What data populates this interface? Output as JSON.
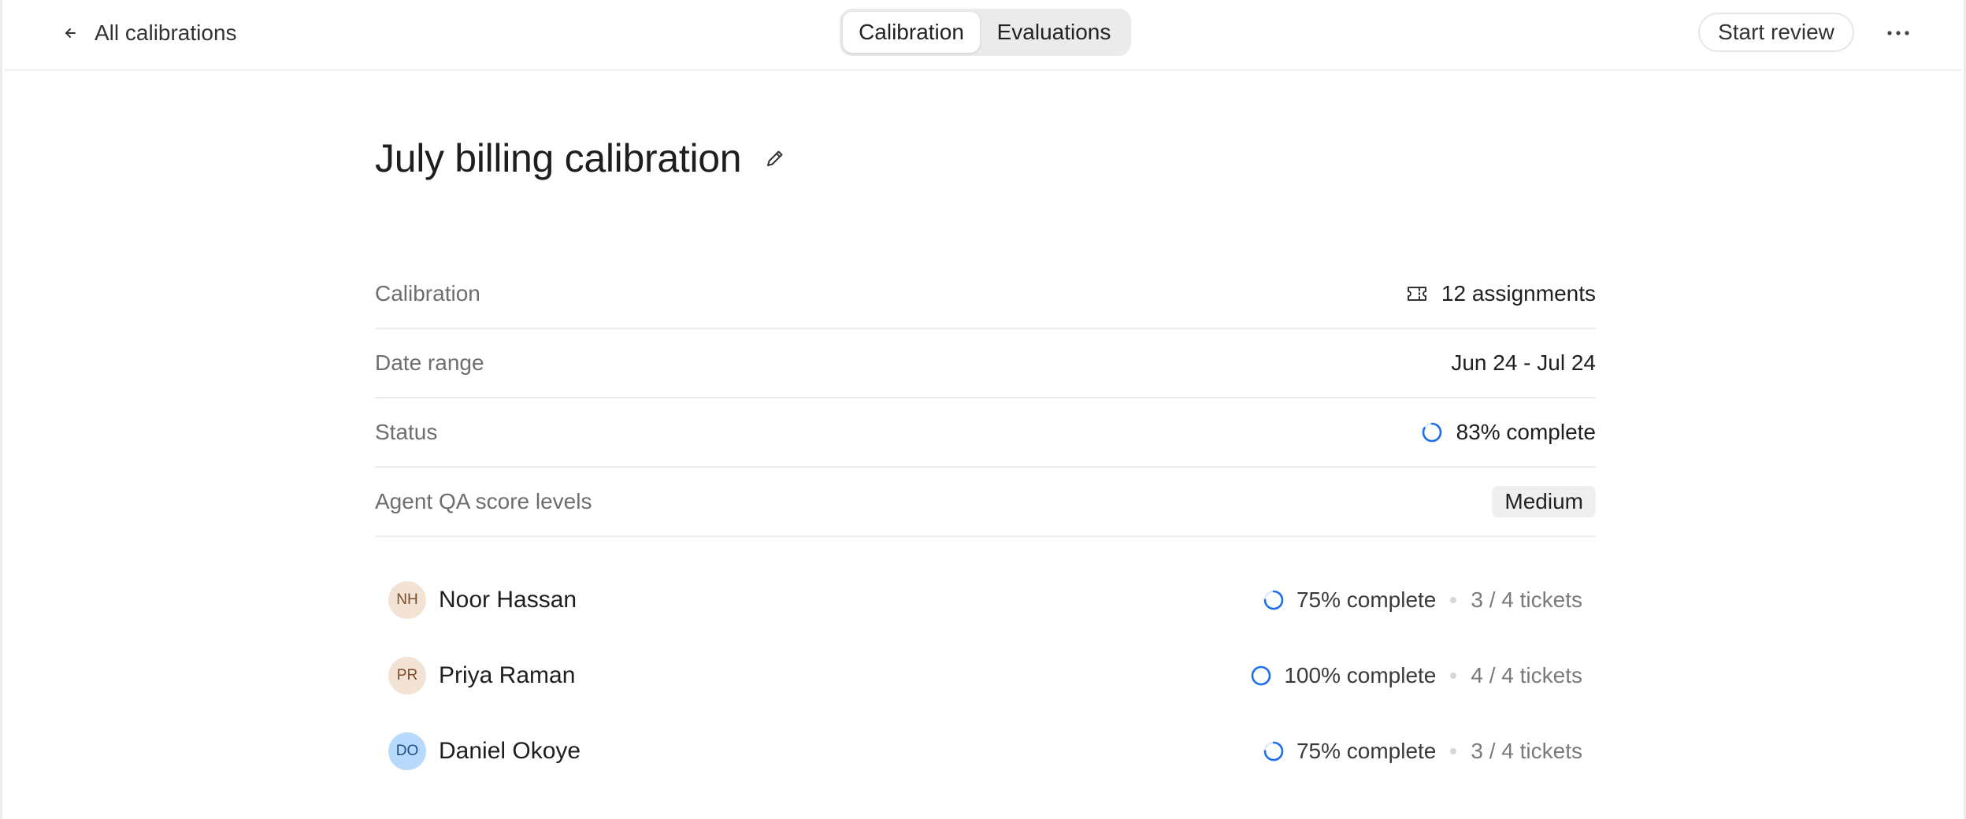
{
  "header": {
    "back_label": "All calibrations",
    "tabs": [
      {
        "label": "Calibration",
        "active": true
      },
      {
        "label": "Evaluations",
        "active": false
      }
    ],
    "start_review_label": "Start review",
    "more_icon": "more-horizontal-icon"
  },
  "page": {
    "title": "July billing calibration"
  },
  "properties": [
    {
      "label": "Calibration",
      "value": "12 assignments",
      "icon": "ticket-icon"
    },
    {
      "label": "Date range",
      "value": "Jun 24 - Jul 24"
    },
    {
      "label": "Status",
      "value": "83% complete",
      "progress": 0.83,
      "icon": "progress-ring-icon"
    },
    {
      "label": "Agent QA score levels",
      "value": "Medium"
    }
  ],
  "reviewers": [
    {
      "initials": "NH",
      "name": "Noor Hassan",
      "progress_label": "75% complete",
      "progress": 0.75,
      "tickets": "3 / 4 tickets",
      "avatar_bg": "#f3e3d5",
      "avatar_fg": "#7a4a2a"
    },
    {
      "initials": "PR",
      "name": "Priya Raman",
      "progress_label": "100% complete",
      "progress": 1.0,
      "tickets": "4 / 4 tickets",
      "avatar_bg": "#f3e3d5",
      "avatar_fg": "#7a4a2a"
    },
    {
      "initials": "DO",
      "name": "Daniel Okoye",
      "progress_label": "75% complete",
      "progress": 0.75,
      "tickets": "3 / 4 tickets",
      "avatar_bg": "#b7d9fb",
      "avatar_fg": "#1f4f86"
    }
  ],
  "colors": {
    "accent": "#1f6feb",
    "ring_track": "#dfe9fb"
  }
}
